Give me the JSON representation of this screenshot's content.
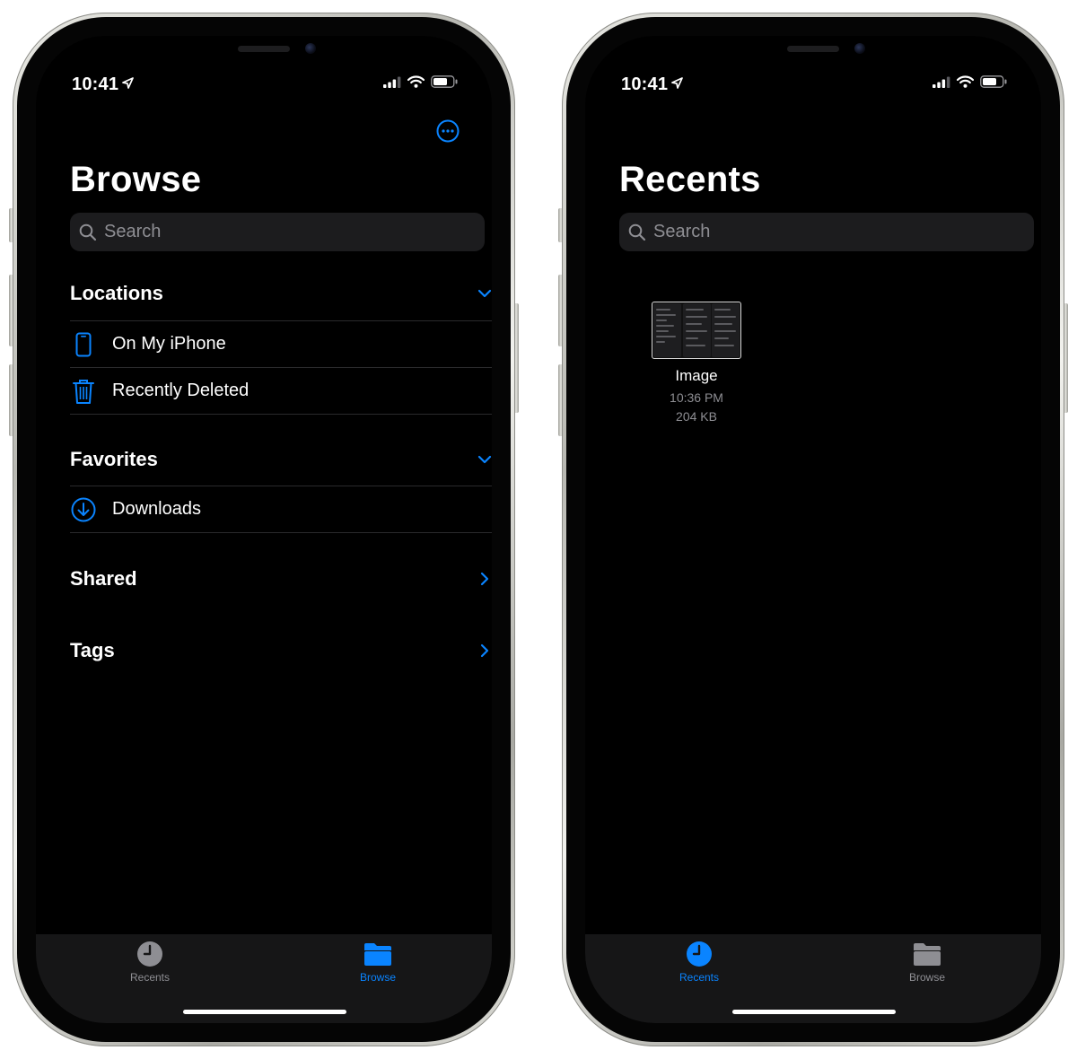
{
  "colors": {
    "accent": "#0a84ff",
    "secondary_text": "#8e8e93",
    "inactive_tab": "#8e8e93",
    "background": "#000000"
  },
  "left_phone": {
    "status": {
      "time": "10:41"
    },
    "nav_more_icon": "ellipsis-circle-icon",
    "title": "Browse",
    "search": {
      "placeholder": "Search"
    },
    "sections": {
      "locations": {
        "title": "Locations",
        "items": [
          {
            "label": "On My iPhone",
            "icon": "iphone-icon"
          },
          {
            "label": "Recently Deleted",
            "icon": "trash-icon"
          }
        ]
      },
      "favorites": {
        "title": "Favorites",
        "items": [
          {
            "label": "Downloads",
            "icon": "download-circle-icon"
          }
        ]
      },
      "shared": {
        "title": "Shared"
      },
      "tags": {
        "title": "Tags"
      }
    },
    "tabbar": {
      "recents": "Recents",
      "browse": "Browse",
      "active": "browse"
    }
  },
  "right_phone": {
    "status": {
      "time": "10:41"
    },
    "title": "Recents",
    "search": {
      "placeholder": "Search"
    },
    "files": [
      {
        "name": "Image",
        "time": "10:36 PM",
        "size": "204 KB"
      }
    ],
    "tabbar": {
      "recents": "Recents",
      "browse": "Browse",
      "active": "recents"
    }
  }
}
